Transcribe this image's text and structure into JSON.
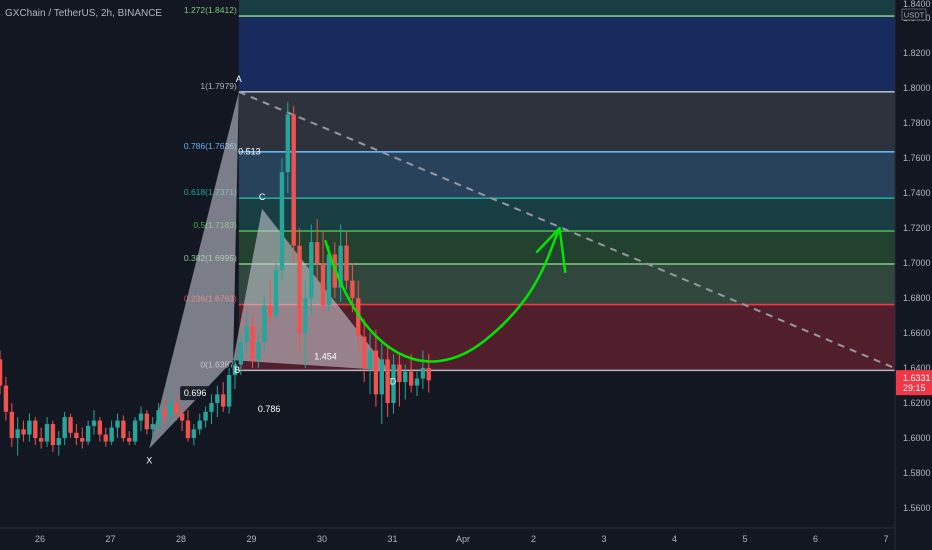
{
  "header": {
    "title": "GXChain / TetherUS, 2h, BINANCE"
  },
  "currency_badge": "USDT",
  "price_box": {
    "price": "1.6331",
    "countdown": "29:15",
    "color": "#f23645"
  },
  "chart_data": {
    "type": "candlestick",
    "ylim": [
      1.5486,
      1.8504
    ],
    "y_ticks": [
      {
        "v": 1.84,
        "t": "1.8400"
      },
      {
        "v": 1.82,
        "t": "1.8200"
      },
      {
        "v": 1.8,
        "t": "1.8000"
      },
      {
        "v": 1.78,
        "t": "1.7800"
      },
      {
        "v": 1.76,
        "t": "1.7600"
      },
      {
        "v": 1.74,
        "t": "1.7400"
      },
      {
        "v": 1.72,
        "t": "1.7200"
      },
      {
        "v": 1.7,
        "t": "1.7000"
      },
      {
        "v": 1.68,
        "t": "1.6800"
      },
      {
        "v": 1.66,
        "t": "1.6600"
      },
      {
        "v": 1.64,
        "t": "1.6400"
      },
      {
        "v": 1.62,
        "t": "1.6200"
      },
      {
        "v": 1.6,
        "t": "1.6000"
      },
      {
        "v": 1.58,
        "t": "1.5800"
      },
      {
        "v": 1.56,
        "t": "1.5600"
      }
    ],
    "top_tick": "1.8400",
    "x_days": [
      26,
      27,
      28,
      29,
      30,
      31,
      32,
      33,
      34,
      35,
      36,
      37
    ],
    "x_ticks": [
      {
        "d": 26,
        "t": "26"
      },
      {
        "d": 27,
        "t": "27"
      },
      {
        "d": 28,
        "t": "28"
      },
      {
        "d": 29,
        "t": "29"
      },
      {
        "d": 30,
        "t": "30"
      },
      {
        "d": 31,
        "t": "31"
      },
      {
        "d": 32,
        "t": "Apr"
      },
      {
        "d": 33,
        "t": "2"
      },
      {
        "d": 34,
        "t": "3"
      },
      {
        "d": 35,
        "t": "4"
      },
      {
        "d": 36,
        "t": "5"
      },
      {
        "d": 37,
        "t": "6"
      },
      {
        "d": 38,
        "t": "7"
      }
    ],
    "candles_start_day": 25.35,
    "candle_step_days": 0.0833,
    "candles": [
      [
        1.64,
        1.652,
        1.63,
        1.645
      ],
      [
        1.645,
        1.65,
        1.625,
        1.63
      ],
      [
        1.63,
        1.635,
        1.61,
        1.615
      ],
      [
        1.615,
        1.62,
        1.595,
        1.6
      ],
      [
        1.6,
        1.612,
        1.59,
        1.605
      ],
      [
        1.605,
        1.61,
        1.598,
        1.602
      ],
      [
        1.602,
        1.614,
        1.598,
        1.61
      ],
      [
        1.61,
        1.612,
        1.596,
        1.6
      ],
      [
        1.6,
        1.606,
        1.594,
        1.598
      ],
      [
        1.598,
        1.612,
        1.595,
        1.608
      ],
      [
        1.608,
        1.61,
        1.592,
        1.596
      ],
      [
        1.596,
        1.604,
        1.59,
        1.6
      ],
      [
        1.6,
        1.615,
        1.596,
        1.612
      ],
      [
        1.612,
        1.614,
        1.6,
        1.603
      ],
      [
        1.603,
        1.608,
        1.596,
        1.6
      ],
      [
        1.6,
        1.606,
        1.594,
        1.598
      ],
      [
        1.598,
        1.61,
        1.596,
        1.607
      ],
      [
        1.607,
        1.616,
        1.602,
        1.61
      ],
      [
        1.61,
        1.612,
        1.598,
        1.602
      ],
      [
        1.602,
        1.606,
        1.595,
        1.598
      ],
      [
        1.598,
        1.61,
        1.596,
        1.606
      ],
      [
        1.606,
        1.614,
        1.6,
        1.61
      ],
      [
        1.61,
        1.613,
        1.598,
        1.6
      ],
      [
        1.6,
        1.604,
        1.596,
        1.598
      ],
      [
        1.598,
        1.612,
        1.596,
        1.61
      ],
      [
        1.61,
        1.618,
        1.604,
        1.614
      ],
      [
        1.614,
        1.616,
        1.602,
        1.605
      ],
      [
        1.605,
        1.612,
        1.6,
        1.608
      ],
      [
        1.608,
        1.62,
        1.604,
        1.616
      ],
      [
        1.616,
        1.622,
        1.608,
        1.612
      ],
      [
        1.612,
        1.625,
        1.608,
        1.62
      ],
      [
        1.62,
        1.624,
        1.61,
        1.614
      ],
      [
        1.614,
        1.618,
        1.604,
        1.61
      ],
      [
        1.61,
        1.616,
        1.598,
        1.6
      ],
      [
        1.6,
        1.608,
        1.596,
        1.605
      ],
      [
        1.605,
        1.614,
        1.602,
        1.61
      ],
      [
        1.61,
        1.618,
        1.606,
        1.615
      ],
      [
        1.615,
        1.625,
        1.608,
        1.62
      ],
      [
        1.62,
        1.63,
        1.612,
        1.625
      ],
      [
        1.625,
        1.632,
        1.615,
        1.618
      ],
      [
        1.618,
        1.64,
        1.614,
        1.636
      ],
      [
        1.636,
        1.648,
        1.628,
        1.642
      ],
      [
        1.642,
        1.66,
        1.636,
        1.655
      ],
      [
        1.655,
        1.672,
        1.648,
        1.664
      ],
      [
        1.664,
        1.67,
        1.64,
        1.645
      ],
      [
        1.645,
        1.66,
        1.64,
        1.655
      ],
      [
        1.655,
        1.68,
        1.65,
        1.676
      ],
      [
        1.676,
        1.69,
        1.665,
        1.67
      ],
      [
        1.67,
        1.7,
        1.668,
        1.696
      ],
      [
        1.696,
        1.76,
        1.69,
        1.752
      ],
      [
        1.752,
        1.792,
        1.74,
        1.785
      ],
      [
        1.785,
        1.79,
        1.7,
        1.71
      ],
      [
        1.71,
        1.72,
        1.65,
        1.66
      ],
      [
        1.66,
        1.69,
        1.64,
        1.68
      ],
      [
        1.68,
        1.722,
        1.67,
        1.712
      ],
      [
        1.712,
        1.725,
        1.69,
        1.7
      ],
      [
        1.7,
        1.718,
        1.672,
        1.676
      ],
      [
        1.676,
        1.71,
        1.672,
        1.705
      ],
      [
        1.705,
        1.712,
        1.68,
        1.686
      ],
      [
        1.686,
        1.722,
        1.678,
        1.71
      ],
      [
        1.71,
        1.718,
        1.685,
        1.69
      ],
      [
        1.69,
        1.7,
        1.672,
        1.68
      ],
      [
        1.68,
        1.69,
        1.65,
        1.658
      ],
      [
        1.658,
        1.668,
        1.632,
        1.64
      ],
      [
        1.64,
        1.66,
        1.625,
        1.65
      ],
      [
        1.65,
        1.662,
        1.618,
        1.625
      ],
      [
        1.625,
        1.654,
        1.608,
        1.645
      ],
      [
        1.645,
        1.652,
        1.612,
        1.62
      ],
      [
        1.62,
        1.648,
        1.614,
        1.642
      ],
      [
        1.642,
        1.648,
        1.618,
        1.632
      ],
      [
        1.632,
        1.642,
        1.622,
        1.638
      ],
      [
        1.638,
        1.648,
        1.626,
        1.63
      ],
      [
        1.63,
        1.638,
        1.624,
        1.634
      ],
      [
        1.634,
        1.65,
        1.628,
        1.64
      ],
      [
        1.64,
        1.648,
        1.626,
        1.633
      ]
    ],
    "fib_left_day": 28.82,
    "fib_right_day": 38.2,
    "fib_levels": [
      {
        "v": 1.8412,
        "label": "1.272(1.8412)",
        "color": "#81c784"
      },
      {
        "v": 1.7979,
        "label": "1(1.7979)",
        "color": "#b2b5be"
      },
      {
        "v": 1.7636,
        "label": "0.786(1.7636)",
        "color": "#64b5f6"
      },
      {
        "v": 1.7371,
        "label": "0.618(1.7371)",
        "color": "#26a69a"
      },
      {
        "v": 1.7183,
        "label": "0.5(1.7183)",
        "color": "#4caf50"
      },
      {
        "v": 1.6995,
        "label": "0.382(1.6995)",
        "color": "#81c784"
      },
      {
        "v": 1.6763,
        "label": "0.236(1.6763)",
        "color": "#f23645"
      },
      {
        "v": 1.6387,
        "label": "0(1.6387)",
        "color": "#b2b5be"
      }
    ],
    "fib_bands": [
      {
        "top": 1.8504,
        "bottom": 1.8412,
        "color": "#26a69a"
      },
      {
        "top": 1.8412,
        "bottom": 1.7979,
        "color": "#2962ff"
      },
      {
        "top": 1.7979,
        "bottom": 1.7636,
        "color": "#787b86"
      },
      {
        "top": 1.7636,
        "bottom": 1.7371,
        "color": "#64b5f6"
      },
      {
        "top": 1.7371,
        "bottom": 1.7183,
        "color": "#26a69a"
      },
      {
        "top": 1.7183,
        "bottom": 1.6995,
        "color": "#4caf50"
      },
      {
        "top": 1.6995,
        "bottom": 1.6763,
        "color": "#81c784"
      },
      {
        "top": 1.6763,
        "bottom": 1.6387,
        "color": "#f23645"
      }
    ],
    "pattern_points": {
      "X": {
        "d": 27.55,
        "v": 1.594
      },
      "A": {
        "d": 28.82,
        "v": 1.7979
      },
      "B": {
        "d": 28.74,
        "v": 1.6445
      },
      "C": {
        "d": 29.15,
        "v": 1.731
      },
      "D": {
        "d": 30.95,
        "v": 1.6387
      }
    },
    "pattern_labels": [
      {
        "pt": "X",
        "text": "X"
      },
      {
        "pt": "A",
        "text": "A"
      },
      {
        "pt": "B",
        "text": "B"
      },
      {
        "pt": "C",
        "text": "C"
      },
      {
        "pt": "D",
        "text": "D"
      }
    ],
    "ratio_labels": [
      {
        "text": "0.696",
        "d": 28.2,
        "v": 1.624,
        "boxed": true
      },
      {
        "text": "0.513",
        "d": 28.97,
        "v": 1.762,
        "boxed": false
      },
      {
        "text": "0.786",
        "d": 29.25,
        "v": 1.615,
        "boxed": false
      },
      {
        "text": "1.454",
        "d": 30.05,
        "v": 1.645,
        "boxed": false
      }
    ],
    "trendline": {
      "from": {
        "d": 28.82,
        "v": 1.7979
      },
      "to": {
        "d": 38.2,
        "v": 1.6387
      },
      "color": "#9598a1"
    },
    "hand_drawn_arrow_color": "#00e600"
  }
}
